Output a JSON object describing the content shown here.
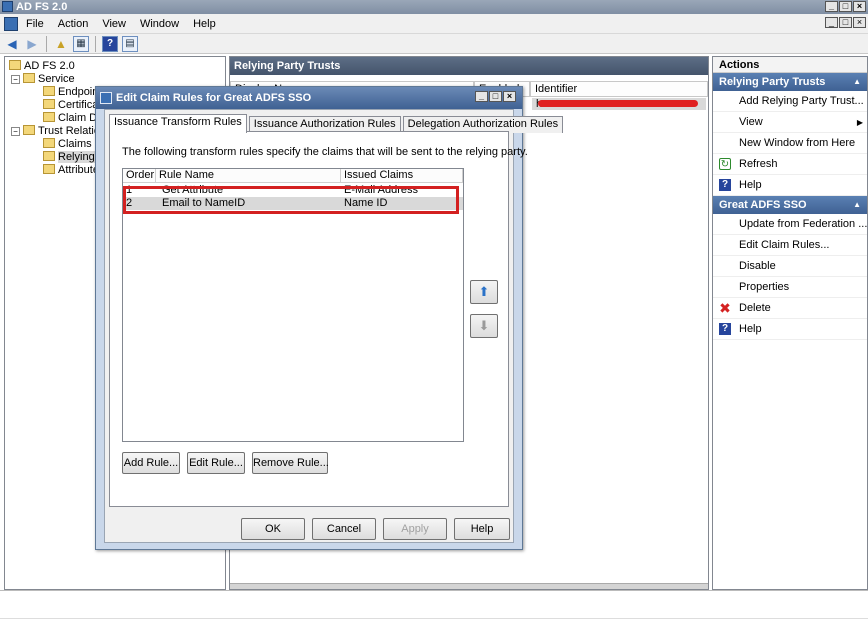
{
  "window": {
    "title": "AD FS 2.0",
    "controls": [
      "_",
      "□",
      "×"
    ]
  },
  "menubar": {
    "items": [
      "File",
      "Action",
      "View",
      "Window",
      "Help"
    ]
  },
  "toolbar": {
    "icons": [
      "back-arrow-icon",
      "forward-arrow-icon",
      "up-folder-icon",
      "show-hide-tree-icon",
      "help-icon",
      "properties-icon"
    ]
  },
  "tree": {
    "root": "AD FS 2.0",
    "service": "Service",
    "service_children": [
      "Endpoint",
      "Certificat",
      "Claim Des"
    ],
    "trust": "Trust Relatio",
    "trust_children": [
      "Claims Pr",
      "Relying P",
      "Attribute"
    ]
  },
  "center": {
    "title": "Relying Party Trusts",
    "columns": [
      "Display N",
      "Enabled",
      "Identifier"
    ],
    "identifier_prefix": "h"
  },
  "actions": {
    "title": "Actions",
    "section1": "Relying Party Trusts",
    "section1_items": [
      "Add Relying Party Trust...",
      "View",
      "New Window from Here",
      "Refresh",
      "Help"
    ],
    "section2": "Great ADFS SSO",
    "section2_items": [
      "Update from Federation ...",
      "Edit Claim Rules...",
      "Disable",
      "Properties",
      "Delete",
      "Help"
    ]
  },
  "dialog": {
    "title": "Edit Claim Rules for Great ADFS SSO",
    "tabs": [
      "Issuance Transform Rules",
      "Issuance Authorization Rules",
      "Delegation Authorization Rules"
    ],
    "description": "The following transform rules specify the claims that will be sent to the relying party.",
    "columns": [
      "Order",
      "Rule Name",
      "Issued Claims"
    ],
    "rules": [
      {
        "order": "1",
        "name": "Get Attribute",
        "claims": "E-Mail Address"
      },
      {
        "order": "2",
        "name": "Email to NameID",
        "claims": "Name ID"
      }
    ],
    "add_rule": "Add Rule...",
    "edit_rule": "Edit Rule...",
    "remove_rule": "Remove Rule...",
    "ok": "OK",
    "cancel": "Cancel",
    "apply": "Apply",
    "help": "Help"
  },
  "colors": {
    "highlight": "#d32020",
    "section_header": "#3f6193"
  }
}
